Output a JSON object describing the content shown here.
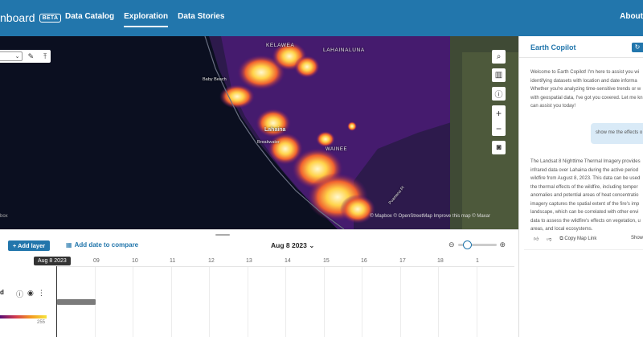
{
  "header": {
    "brand": "nboard",
    "beta": "BETA",
    "nav": [
      {
        "label": "Data Catalog",
        "active": false
      },
      {
        "label": "Exploration",
        "active": true
      },
      {
        "label": "Data Stories",
        "active": false
      }
    ],
    "about": "About"
  },
  "map": {
    "labels": [
      {
        "text": "KELAWEA",
        "key": "kelawea"
      },
      {
        "text": "LAHAINALUNA",
        "key": "lahainaluna"
      },
      {
        "text": "Baby Beach",
        "key": "baby_beach"
      },
      {
        "text": "Lahaina",
        "key": "lahaina"
      },
      {
        "text": "Breakwater",
        "key": "breakwater"
      },
      {
        "text": "WAINEE",
        "key": "wainee"
      },
      {
        "text": "Puamana Pl",
        "key": "puamana"
      }
    ],
    "attribution": "© Mapbox © OpenStreetMap  Improve this map © Maxar",
    "logo": "box",
    "icons": [
      "pencil-icon",
      "upload-icon",
      "search-icon",
      "map-layers-icon",
      "info-icon",
      "zoom-in-icon",
      "zoom-out-icon",
      "robot-icon"
    ]
  },
  "timeline": {
    "add_layer": "+ Add layer",
    "add_date": "Add date to compare",
    "selected_date": "Aug 8 2023",
    "date_badge": "Aug 8 2023",
    "ticks": [
      "09",
      "10",
      "11",
      "12",
      "13",
      "14",
      "15",
      "16",
      "17",
      "18",
      "1"
    ],
    "layer_name": "d",
    "legend_max": "255"
  },
  "copilot": {
    "title": "Earth Copilot",
    "intro": [
      "Welcome to Earth Copilot! I'm here to assist you wi",
      "identifying datasets with location and date informa",
      "Whether you're analyzing time-sensitive trends or w",
      "with geospatial data, I've got you covered. Let me kn",
      "can assist you today!"
    ],
    "user_message": "show me the effects o",
    "response": [
      "The Landsat 8 Nighttime Thermal Imagery provides",
      "infrared data over Lahaina during the active period",
      "wildfire from August 8, 2023. This data can be used",
      "the thermal effects of the wildfire, including temper",
      "anomalies and potential areas of heat concentratio",
      "imagery captures the spatial extent of the fire's imp",
      "landscape, which can be correlated with other envi",
      "data to assess the wildfire's effects on vegetation, u",
      "areas, and local ecosystems."
    ],
    "copy_map_link": "Copy Map Link",
    "show": "Show"
  },
  "colors": {
    "brand": "#2276ac",
    "map_background": "#0b0f20",
    "heat_low": "#5a0d75",
    "heat_mid": "#f49a21",
    "heat_high": "#fff5c4"
  }
}
